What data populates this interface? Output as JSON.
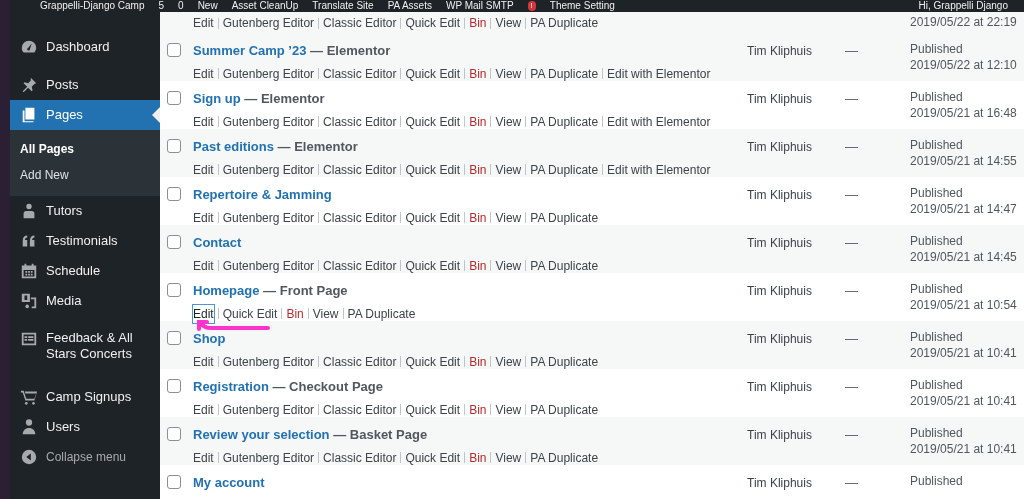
{
  "admin_bar": {
    "site": "Grappelli-Django Camp",
    "updates": "5",
    "comments": "0",
    "new": "New",
    "items": [
      "Asset CleanUp",
      "Translate Site",
      "PA Assets",
      "WP Mail SMTP",
      "Theme Setting"
    ],
    "notice_badge": "!",
    "greeting": "Hi, Grappelli Django"
  },
  "sidebar": {
    "items": [
      {
        "label": "Dashboard",
        "selected": false
      },
      {
        "label": "Posts",
        "selected": false
      },
      {
        "label": "Pages",
        "selected": true,
        "children": [
          {
            "label": "All Pages",
            "selected": true
          },
          {
            "label": "Add New",
            "selected": false
          }
        ]
      },
      {
        "label": "Tutors",
        "selected": false
      },
      {
        "label": "Testimonials",
        "selected": false
      },
      {
        "label": "Schedule",
        "selected": false
      },
      {
        "label": "Media",
        "selected": false
      },
      {
        "label": "Feedback & All Stars Concerts",
        "selected": false
      },
      {
        "label": "Camp Signups",
        "selected": false
      },
      {
        "label": "Users",
        "selected": false
      }
    ],
    "collapse": "Collapse menu"
  },
  "rows": [
    {
      "kind": "partial",
      "actions": [
        {
          "label": "Edit",
          "kind": "link"
        },
        {
          "label": "Gutenberg Editor",
          "kind": "link"
        },
        {
          "label": "Classic Editor",
          "kind": "link"
        },
        {
          "label": "Quick Edit",
          "kind": "link"
        },
        {
          "label": "Bin",
          "kind": "delete"
        },
        {
          "label": "View",
          "kind": "link"
        },
        {
          "label": "PA Duplicate",
          "kind": "link"
        }
      ],
      "date": "2019/05/22 at 22:19"
    },
    {
      "kind": "full",
      "checked": false,
      "title": "Summer Camp ’23",
      "post_state": "— Elementor",
      "actions": [
        {
          "label": "Edit",
          "kind": "link"
        },
        {
          "label": "Gutenberg Editor",
          "kind": "link"
        },
        {
          "label": "Classic Editor",
          "kind": "link"
        },
        {
          "label": "Quick Edit",
          "kind": "link"
        },
        {
          "label": "Bin",
          "kind": "delete"
        },
        {
          "label": "View",
          "kind": "link"
        },
        {
          "label": "PA Duplicate",
          "kind": "link"
        },
        {
          "label": "Edit with Elementor",
          "kind": "link"
        }
      ],
      "author": "Tim Kliphuis",
      "comments": "—",
      "status": "Published",
      "date": "2019/05/22 at 12:10"
    },
    {
      "kind": "full",
      "checked": false,
      "title": "Sign up",
      "post_state": "— Elementor",
      "actions": [
        {
          "label": "Edit",
          "kind": "link"
        },
        {
          "label": "Gutenberg Editor",
          "kind": "link"
        },
        {
          "label": "Classic Editor",
          "kind": "link"
        },
        {
          "label": "Quick Edit",
          "kind": "link"
        },
        {
          "label": "Bin",
          "kind": "delete"
        },
        {
          "label": "View",
          "kind": "link"
        },
        {
          "label": "PA Duplicate",
          "kind": "link"
        },
        {
          "label": "Edit with Elementor",
          "kind": "link"
        }
      ],
      "author": "Tim Kliphuis",
      "comments": "—",
      "status": "Published",
      "date": "2019/05/21 at 16:48"
    },
    {
      "kind": "full",
      "checked": false,
      "title": "Past editions",
      "post_state": "— Elementor",
      "actions": [
        {
          "label": "Edit",
          "kind": "link"
        },
        {
          "label": "Gutenberg Editor",
          "kind": "link"
        },
        {
          "label": "Classic Editor",
          "kind": "link"
        },
        {
          "label": "Quick Edit",
          "kind": "link"
        },
        {
          "label": "Bin",
          "kind": "delete"
        },
        {
          "label": "View",
          "kind": "link"
        },
        {
          "label": "PA Duplicate",
          "kind": "link"
        },
        {
          "label": "Edit with Elementor",
          "kind": "link"
        }
      ],
      "author": "Tim Kliphuis",
      "comments": "—",
      "status": "Published",
      "date": "2019/05/21 at 14:55"
    },
    {
      "kind": "full",
      "checked": false,
      "title": "Repertoire & Jamming",
      "actions": [
        {
          "label": "Edit",
          "kind": "link"
        },
        {
          "label": "Gutenberg Editor",
          "kind": "link"
        },
        {
          "label": "Classic Editor",
          "kind": "link"
        },
        {
          "label": "Quick Edit",
          "kind": "link"
        },
        {
          "label": "Bin",
          "kind": "delete"
        },
        {
          "label": "View",
          "kind": "link"
        },
        {
          "label": "PA Duplicate",
          "kind": "link"
        }
      ],
      "author": "Tim Kliphuis",
      "comments": "—",
      "status": "Published",
      "date": "2019/05/21 at 14:47"
    },
    {
      "kind": "full",
      "checked": false,
      "title": "Contact",
      "actions": [
        {
          "label": "Edit",
          "kind": "link"
        },
        {
          "label": "Gutenberg Editor",
          "kind": "link"
        },
        {
          "label": "Classic Editor",
          "kind": "link"
        },
        {
          "label": "Quick Edit",
          "kind": "link"
        },
        {
          "label": "Bin",
          "kind": "delete"
        },
        {
          "label": "View",
          "kind": "link"
        },
        {
          "label": "PA Duplicate",
          "kind": "link"
        }
      ],
      "author": "Tim Kliphuis",
      "comments": "—",
      "status": "Published",
      "date": "2019/05/21 at 14:45"
    },
    {
      "kind": "full",
      "checked": false,
      "title": "Homepage",
      "post_state": "— Front Page",
      "actions": [
        {
          "label": "Edit",
          "kind": "focused"
        },
        {
          "label": "Quick Edit",
          "kind": "link"
        },
        {
          "label": "Bin",
          "kind": "delete"
        },
        {
          "label": "View",
          "kind": "link"
        },
        {
          "label": "PA Duplicate",
          "kind": "link"
        }
      ],
      "author": "Tim Kliphuis",
      "comments": "—",
      "status": "Published",
      "date": "2019/05/21 at 10:54"
    },
    {
      "kind": "full",
      "checked": false,
      "title": "Shop",
      "actions": [
        {
          "label": "Edit",
          "kind": "link"
        },
        {
          "label": "Gutenberg Editor",
          "kind": "link"
        },
        {
          "label": "Classic Editor",
          "kind": "link"
        },
        {
          "label": "Quick Edit",
          "kind": "link"
        },
        {
          "label": "Bin",
          "kind": "delete"
        },
        {
          "label": "View",
          "kind": "link"
        },
        {
          "label": "PA Duplicate",
          "kind": "link"
        }
      ],
      "author": "Tim Kliphuis",
      "comments": "—",
      "status": "Published",
      "date": "2019/05/21 at 10:41"
    },
    {
      "kind": "full",
      "checked": false,
      "title": "Registration",
      "post_state": "— Checkout Page",
      "actions": [
        {
          "label": "Edit",
          "kind": "link"
        },
        {
          "label": "Gutenberg Editor",
          "kind": "link"
        },
        {
          "label": "Classic Editor",
          "kind": "link"
        },
        {
          "label": "Quick Edit",
          "kind": "link"
        },
        {
          "label": "Bin",
          "kind": "delete"
        },
        {
          "label": "View",
          "kind": "link"
        },
        {
          "label": "PA Duplicate",
          "kind": "link"
        }
      ],
      "author": "Tim Kliphuis",
      "comments": "—",
      "status": "Published",
      "date": "2019/05/21 at 10:41"
    },
    {
      "kind": "full",
      "checked": false,
      "title": "Review your selection",
      "post_state": "— Basket Page",
      "actions": [
        {
          "label": "Edit",
          "kind": "link"
        },
        {
          "label": "Gutenberg Editor",
          "kind": "link"
        },
        {
          "label": "Classic Editor",
          "kind": "link"
        },
        {
          "label": "Quick Edit",
          "kind": "link"
        },
        {
          "label": "Bin",
          "kind": "delete"
        },
        {
          "label": "View",
          "kind": "link"
        },
        {
          "label": "PA Duplicate",
          "kind": "link"
        }
      ],
      "author": "Tim Kliphuis",
      "comments": "—",
      "status": "Published",
      "date": "2019/05/21 at 10:41"
    },
    {
      "kind": "full",
      "checked": false,
      "title": "My account",
      "actions": [],
      "author": "Tim Kliphuis",
      "comments": "—",
      "status": "Published"
    }
  ],
  "annotation": {
    "kind": "arrow",
    "color": "#ff33cc"
  }
}
